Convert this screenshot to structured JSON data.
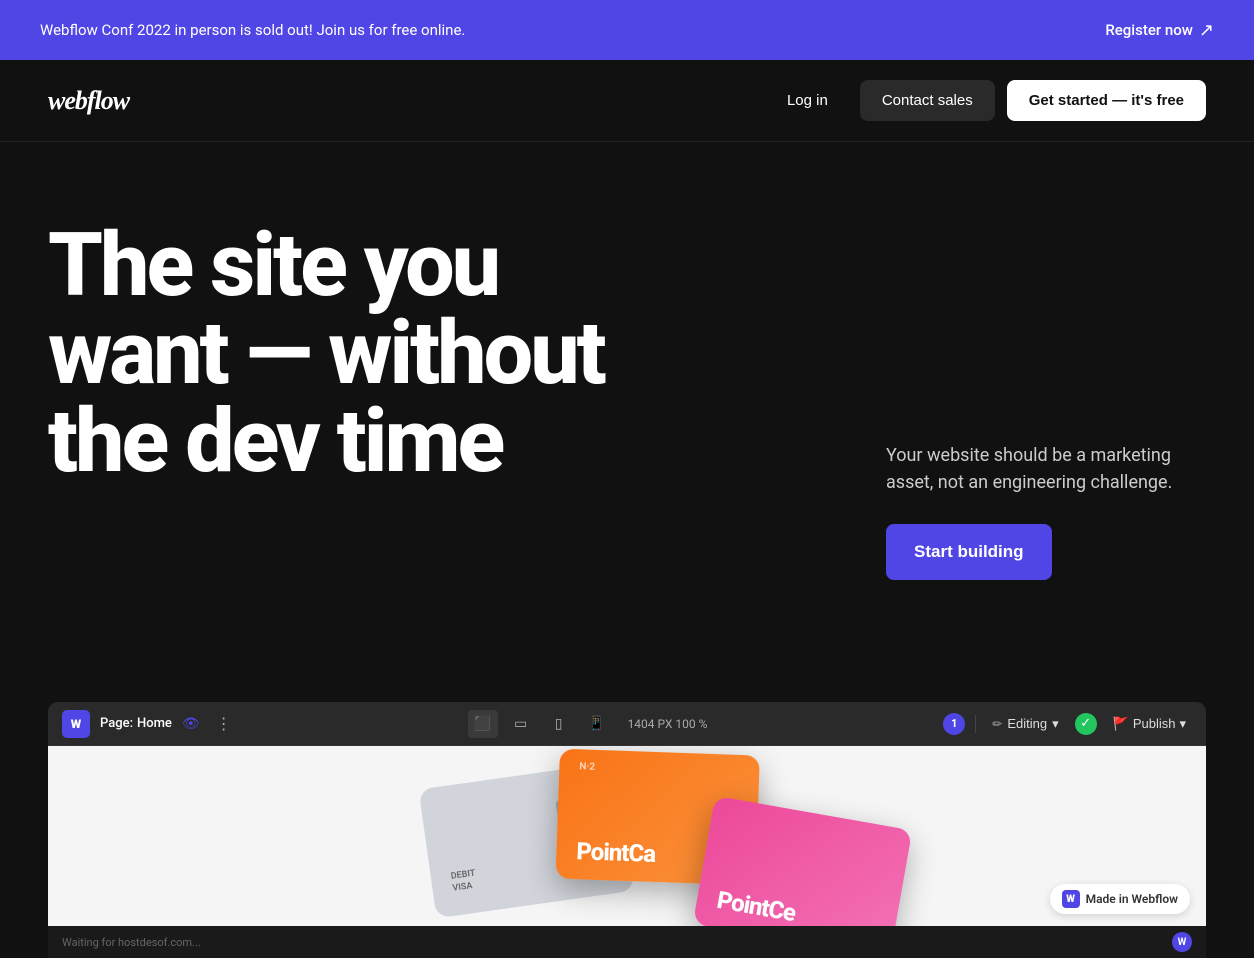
{
  "banner": {
    "text": "Webflow Conf 2022 in person is sold out! Join us for free online.",
    "register_label": "Register now",
    "arrow": "↗"
  },
  "navbar": {
    "logo": "webflow",
    "login_label": "Log in",
    "contact_sales_label": "Contact sales",
    "get_started_label": "Get started — it's free"
  },
  "hero": {
    "headline_line1": "The site you",
    "headline_line2": "want — without",
    "headline_line3": "the dev time",
    "subtext": "Your website should be a marketing asset, not an engineering challenge.",
    "cta_label": "Start building"
  },
  "editor": {
    "webflow_icon": "W",
    "page_label": "Page:",
    "page_name": "Home",
    "resolution": "1404 PX   100 %",
    "editing_label": "Editing",
    "publish_label": "Publish",
    "user_badge": "1"
  },
  "cards": {
    "orange_brand": "PointCa",
    "orange_n2": "N·2",
    "pink_brand": "PointCe",
    "gray_type": "DEBIT",
    "gray_network": "VISA"
  },
  "footer_bar": {
    "waiting_text": "Waiting for hostdesof.com...",
    "made_in_webflow": "Made in Webflow",
    "icon": "W"
  }
}
